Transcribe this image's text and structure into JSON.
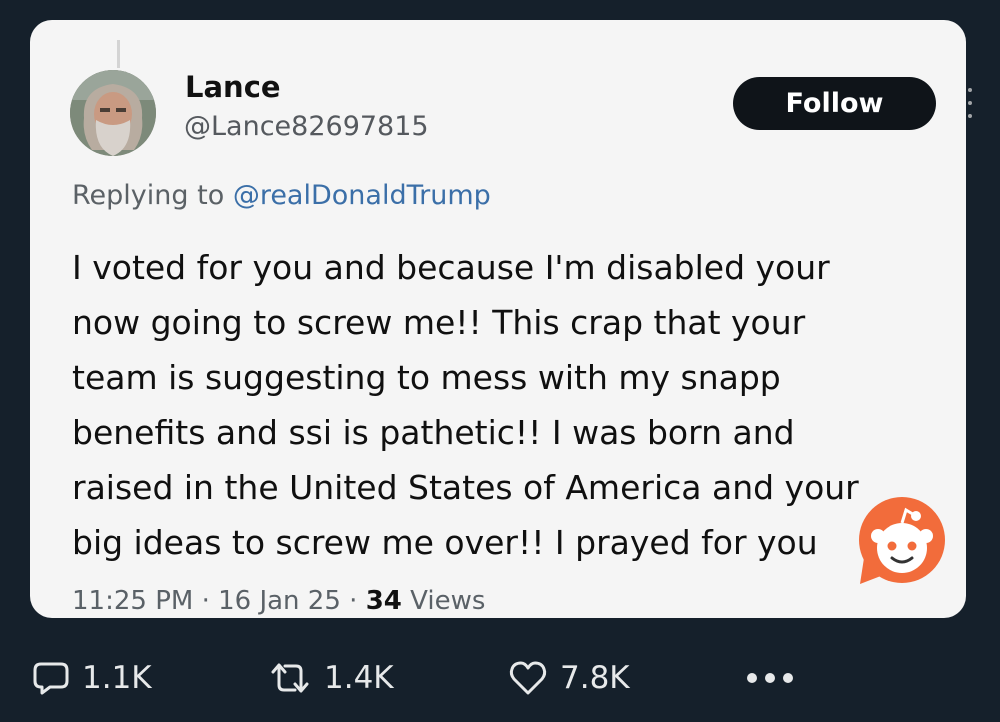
{
  "tweet": {
    "display_name": "Lance",
    "handle": "@Lance82697815",
    "follow_label": "Follow",
    "replying_prefix": "Replying to",
    "replying_handle": "@realDonaldTrump",
    "text_lines": [
      "I voted for you and because I'm disabled your",
      "now going to screw me!! This crap that your",
      "team is suggesting to mess with my snapp",
      "benefits and ssi is pathetic!! I was born and",
      "raised in the United States of America and your",
      "big ideas to screw me over!! I prayed for you"
    ],
    "time": "11:25 PM",
    "separator": "·",
    "date": "16 Jan 25",
    "views_count": "34",
    "views_label": "Views"
  },
  "actions": {
    "replies": "1.1K",
    "reposts": "1.4K",
    "likes": "7.8K"
  },
  "icons": {
    "more_vertical": "more-vertical-icon",
    "reply": "reply-icon",
    "repost": "repost-icon",
    "like": "heart-icon",
    "more_horizontal": "more-horizontal-icon",
    "watermark": "reddit-logo"
  },
  "colors": {
    "page_background": "#15202b",
    "card_background": "#f5f5f5",
    "follow_button": "#0f1419",
    "mention": "#3b6fa8",
    "reddit_orange": "#f26c3b"
  }
}
